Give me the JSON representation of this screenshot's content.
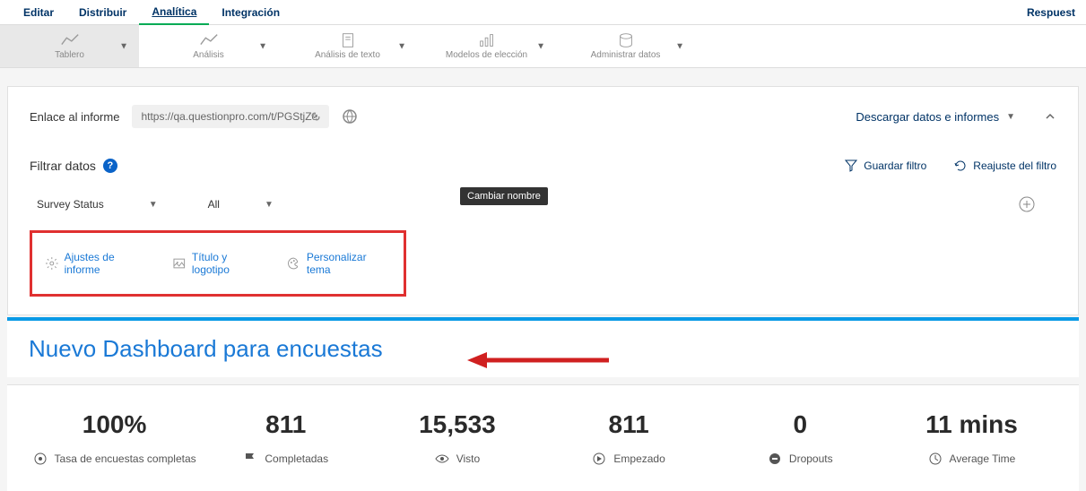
{
  "topnav": {
    "items": [
      "Editar",
      "Distribuir",
      "Analítica",
      "Integración"
    ],
    "active": 2,
    "right": "Respuest"
  },
  "toolbar": {
    "items": [
      {
        "label": "Tablero",
        "icon": "chart"
      },
      {
        "label": "Análisis",
        "icon": "chart"
      },
      {
        "label": "Análisis de texto",
        "icon": "doc"
      },
      {
        "label": "Modelos de elección",
        "icon": "chart"
      },
      {
        "label": "Administrar datos",
        "icon": "db"
      }
    ],
    "active": 0
  },
  "report_link": {
    "label": "Enlace al informe",
    "url": "https://qa.questionpro.com/t/PGStjZe"
  },
  "download": "Descargar datos e informes",
  "filter": {
    "label": "Filtrar datos",
    "save": "Guardar filtro",
    "reset": "Reajuste del filtro",
    "dropdowns": [
      {
        "label": "Survey Status"
      },
      {
        "label": "All"
      }
    ],
    "tooltip": "Cambiar nombre"
  },
  "settings": [
    "Ajustes de informe",
    "Título y logotipo",
    "Personalizar tema"
  ],
  "dashboard_title": "Nuevo Dashboard para encuestas",
  "stats": [
    {
      "value": "100%",
      "label": "Tasa de encuestas completas",
      "icon": "target"
    },
    {
      "value": "811",
      "label": "Completadas",
      "icon": "flag"
    },
    {
      "value": "15,533",
      "label": "Visto",
      "icon": "eye"
    },
    {
      "value": "811",
      "label": "Empezado",
      "icon": "play"
    },
    {
      "value": "0",
      "label": "Dropouts",
      "icon": "minus"
    },
    {
      "value": "11 mins",
      "label": "Average Time",
      "icon": "clock"
    }
  ]
}
